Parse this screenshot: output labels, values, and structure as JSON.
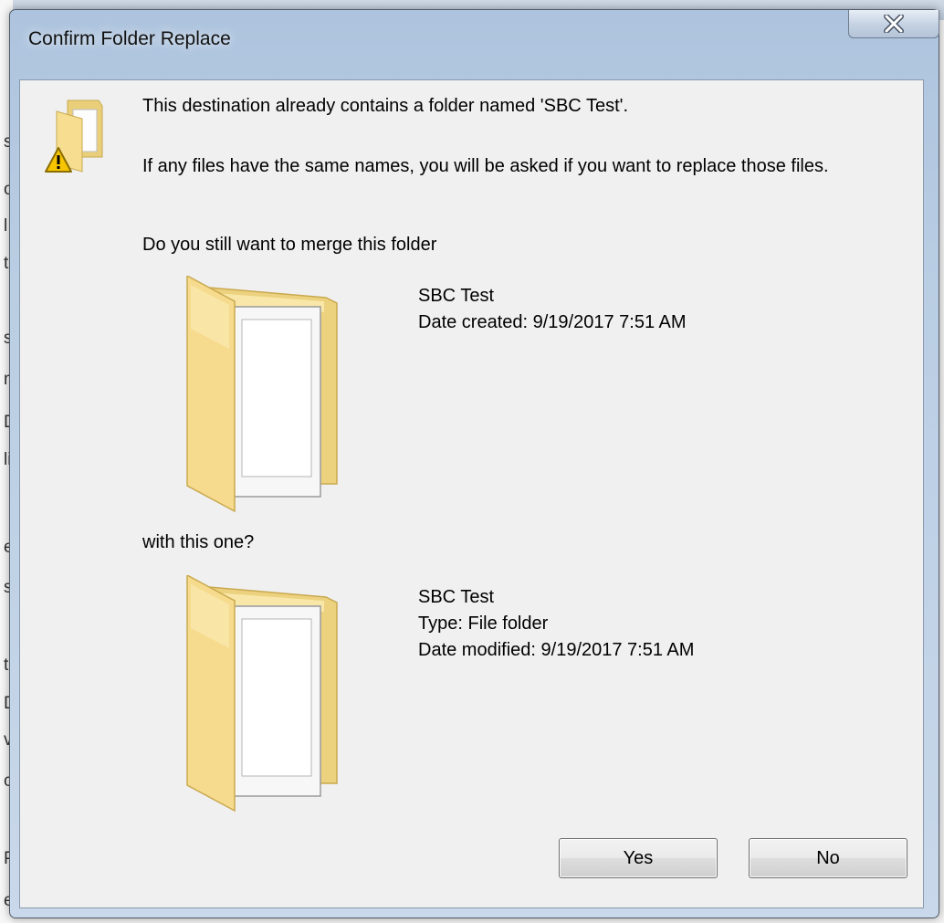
{
  "dialog": {
    "title": "Confirm Folder Replace",
    "message": "This destination already contains a folder named 'SBC Test'.",
    "info": "If any files have the same names, you will be asked if you want to replace those files.",
    "question": "Do you still want to merge this folder",
    "with_label": "with this one?",
    "destination_folder": {
      "name": "SBC Test",
      "date_created": "Date created: 9/19/2017 7:51 AM"
    },
    "source_folder": {
      "name": "SBC Test",
      "type": "Type: File folder",
      "date_modified": "Date modified: 9/19/2017 7:51 AM"
    },
    "buttons": {
      "yes": "Yes",
      "no": "No"
    },
    "close_glyph": "X"
  },
  "icons": {
    "warning": "warning-folder-icon",
    "folder": "folder-with-files-icon",
    "close": "close-icon"
  },
  "colors": {
    "title_bar": "#b9cde3",
    "content_bg": "#f0f0f0",
    "folder_yellow": "#f3d98a",
    "close_x": "#ffffff"
  }
}
